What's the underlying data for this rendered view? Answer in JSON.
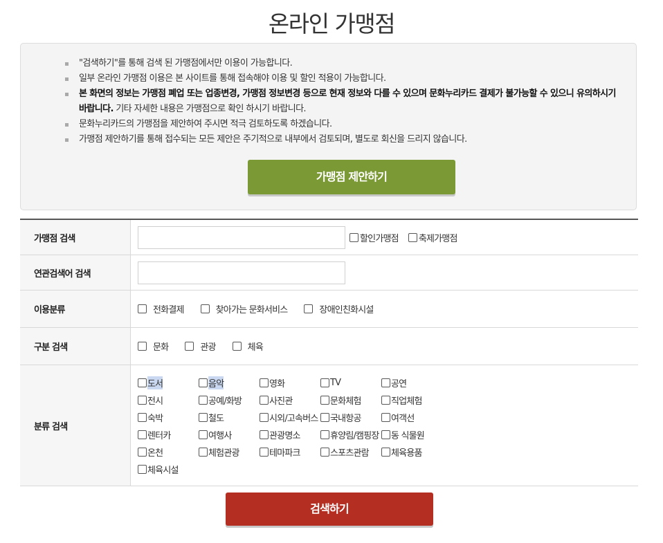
{
  "page": {
    "title": "온라인 가맹점"
  },
  "notice": {
    "items": [
      {
        "text": "\"검색하기\"를 통해 검색 된 가맹점에서만 이용이 가능합니다."
      },
      {
        "text": "일부 온라인 가맹점 이용은 본 사이트를 통해 접속해야 이용 및 할인 적용이 가능합니다."
      },
      {
        "bold": "본 화면의 정보는 가맹점 폐업 또는 업종변경, 가맹점 정보변경 등으로 현재 정보와 다를 수 있으며 문화누리카드 결제가 불가능할 수 있으니 유의하시기 바랍니다.",
        "text": " 기타 자세한 내용은 가맹점으로 확인 하시기 바랍니다."
      },
      {
        "text": "문화누리카드의 가맹점을 제안하여 주시면 적극 검토하도록 하겠습니다."
      },
      {
        "text": "가맹점 제안하기를 통해 접수되는 모든 제안은 주기적으로 내부에서 검토되며, 별도로 회신을 드리지 않습니다."
      }
    ],
    "suggest_button": "가맹점 제안하기"
  },
  "form": {
    "store_search": {
      "label": "가맹점 검색",
      "value": "",
      "options": [
        {
          "label": "할인가맹점",
          "checked": false
        },
        {
          "label": "축제가맹점",
          "checked": false
        }
      ]
    },
    "keyword_search": {
      "label": "연관검색어 검색",
      "value": ""
    },
    "usage": {
      "label": "이용분류",
      "options": [
        {
          "label": "전화결제",
          "checked": false
        },
        {
          "label": "찾아가는 문화서비스",
          "checked": false
        },
        {
          "label": "장애인친화시설",
          "checked": false
        }
      ]
    },
    "division": {
      "label": "구분 검색",
      "options": [
        {
          "label": "문화",
          "checked": false
        },
        {
          "label": "관광",
          "checked": false
        },
        {
          "label": "체육",
          "checked": false
        }
      ]
    },
    "category": {
      "label": "분류 검색",
      "rows": [
        [
          "도서",
          "음악",
          "영화",
          "TV",
          "공연"
        ],
        [
          "전시",
          "공예/화방",
          "사진관",
          "문화체험",
          "직업체험"
        ],
        [
          "숙박",
          "철도",
          "시외/고속버스",
          "국내항공",
          "여객선"
        ],
        [
          "렌터카",
          "여행사",
          "관광명소",
          "휴양림/캠핑장",
          "동 식물원"
        ],
        [
          "온천",
          "체험관광",
          "테마파크",
          "스포츠관람",
          "체육용품"
        ],
        [
          "체육시설"
        ]
      ],
      "highlighted": [
        "도서",
        "음악"
      ]
    },
    "search_button": "검색하기"
  }
}
